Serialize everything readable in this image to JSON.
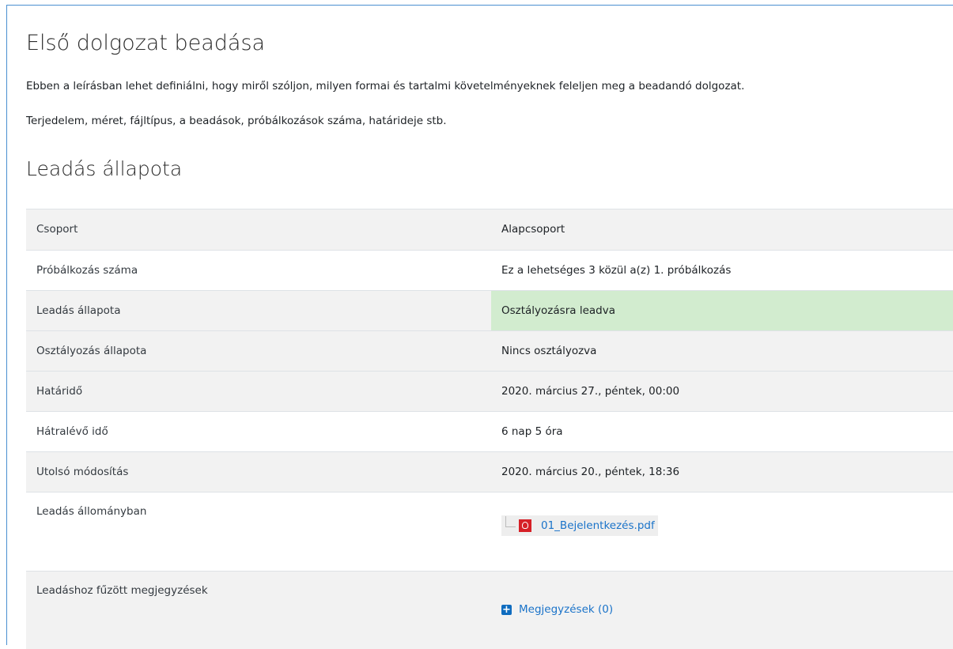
{
  "page": {
    "title": "Első dolgozat beadása",
    "description_1": "Ebben a leírásban lehet definiálni, hogy miről szóljon, milyen formai és tartalmi követelményeknek feleljen meg a beadandó dolgozat.",
    "description_2": "Terjedelem, méret, fájltípus, a beadások, próbálkozások száma, határideje stb."
  },
  "status": {
    "section_title": "Leadás állapota",
    "rows": [
      {
        "label": "Csoport",
        "value": "Alapcsoport"
      },
      {
        "label": "Próbálkozás száma",
        "value": "Ez a lehetséges 3 közül a(z) 1. próbálkozás"
      },
      {
        "label": "Leadás állapota",
        "value": "Osztályozásra leadva"
      },
      {
        "label": "Osztályozás állapota",
        "value": "Nincs osztályozva"
      },
      {
        "label": "Határidő",
        "value": "2020. március 27., péntek, 00:00"
      },
      {
        "label": "Hátralévő idő",
        "value": "6 nap 5 óra"
      },
      {
        "label": "Utolsó módosítás",
        "value": "2020. március 20., péntek, 18:36"
      },
      {
        "label": "Leadás állományban",
        "file_name": "01_Bejelentkezés.pdf",
        "file_icon": "pdf-icon"
      },
      {
        "label": "Leadáshoz fűzött megjegyzések",
        "comments_link": "Megjegyzések (0)",
        "comments_icon": "plus-square-icon"
      }
    ]
  },
  "colors": {
    "submitted_bg": "#d2eccf",
    "link": "#1a73c9",
    "frame": "#4a8fd0"
  }
}
